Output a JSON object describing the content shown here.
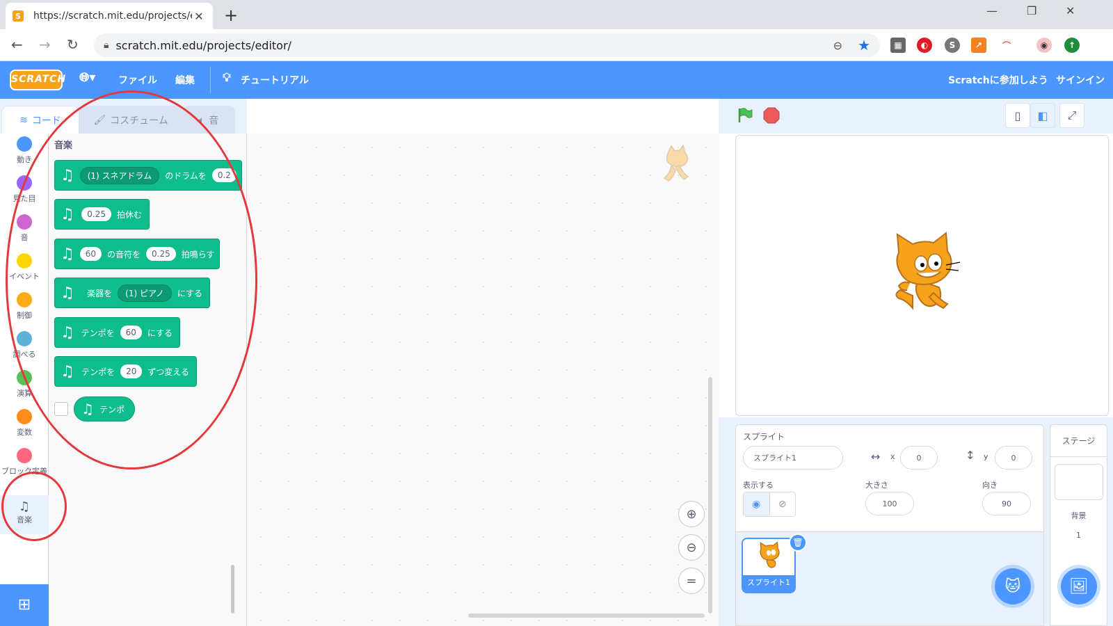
{
  "browser": {
    "tab_title": "https://scratch.mit.edu/projects/e",
    "url": "scratch.mit.edu/projects/editor/"
  },
  "menubar": {
    "logo": "SCRATCH",
    "file": "ファイル",
    "edit": "編集",
    "tutorial": "チュートリアル",
    "join": "Scratchに参加しよう",
    "signin": "サインイン"
  },
  "editor_tabs": [
    {
      "label": "コード"
    },
    {
      "label": "コスチューム"
    },
    {
      "label": "音"
    }
  ],
  "categories": [
    {
      "label": "動き",
      "color": "#4c97ff"
    },
    {
      "label": "見た目",
      "color": "#9966ff"
    },
    {
      "label": "音",
      "color": "#cf63cf"
    },
    {
      "label": "イベント",
      "color": "#ffd500"
    },
    {
      "label": "制御",
      "color": "#ffab19"
    },
    {
      "label": "調べる",
      "color": "#5cb1d6"
    },
    {
      "label": "演算",
      "color": "#59c059"
    },
    {
      "label": "変数",
      "color": "#ff8c1a"
    },
    {
      "label": "ブロック定義",
      "color": "#ff6680"
    },
    {
      "label": "音楽",
      "color": "#0fbd8c"
    }
  ],
  "palette": {
    "title": "音楽",
    "blocks": {
      "drum": {
        "dropdown": "(1) スネアドラム",
        "text": "のドラムを",
        "value": "0.2"
      },
      "rest": {
        "value": "0.25",
        "text": "拍休む"
      },
      "note": {
        "value1": "60",
        "text1": "の音符を",
        "value2": "0.25",
        "text2": "拍鳴らす"
      },
      "instrument": {
        "text1": "楽器を",
        "dropdown": "(1) ピアノ",
        "text2": "にする"
      },
      "set_tempo": {
        "text1": "テンポを",
        "value": "60",
        "text2": "にする"
      },
      "change_tempo": {
        "text1": "テンポを",
        "value": "20",
        "text2": "ずつ変える"
      },
      "tempo_reporter": {
        "text": "テンポ"
      }
    }
  },
  "sprite_info": {
    "sprite_label": "スプライト",
    "sprite_name": "スプライト1",
    "x_label": "x",
    "x_value": "0",
    "y_label": "y",
    "y_value": "0",
    "show_label": "表示する",
    "size_label": "大きさ",
    "size_value": "100",
    "direction_label": "向き",
    "direction_value": "90"
  },
  "sprite_list": {
    "thumb_label": "スプライト1"
  },
  "stage_panel": {
    "title": "ステージ",
    "backdrop_label": "背景",
    "backdrop_count": "1"
  },
  "colors": {
    "scratch_blue": "#4c97ff",
    "music_green": "#0fbd8c",
    "annotation_red": "#e5383b"
  }
}
